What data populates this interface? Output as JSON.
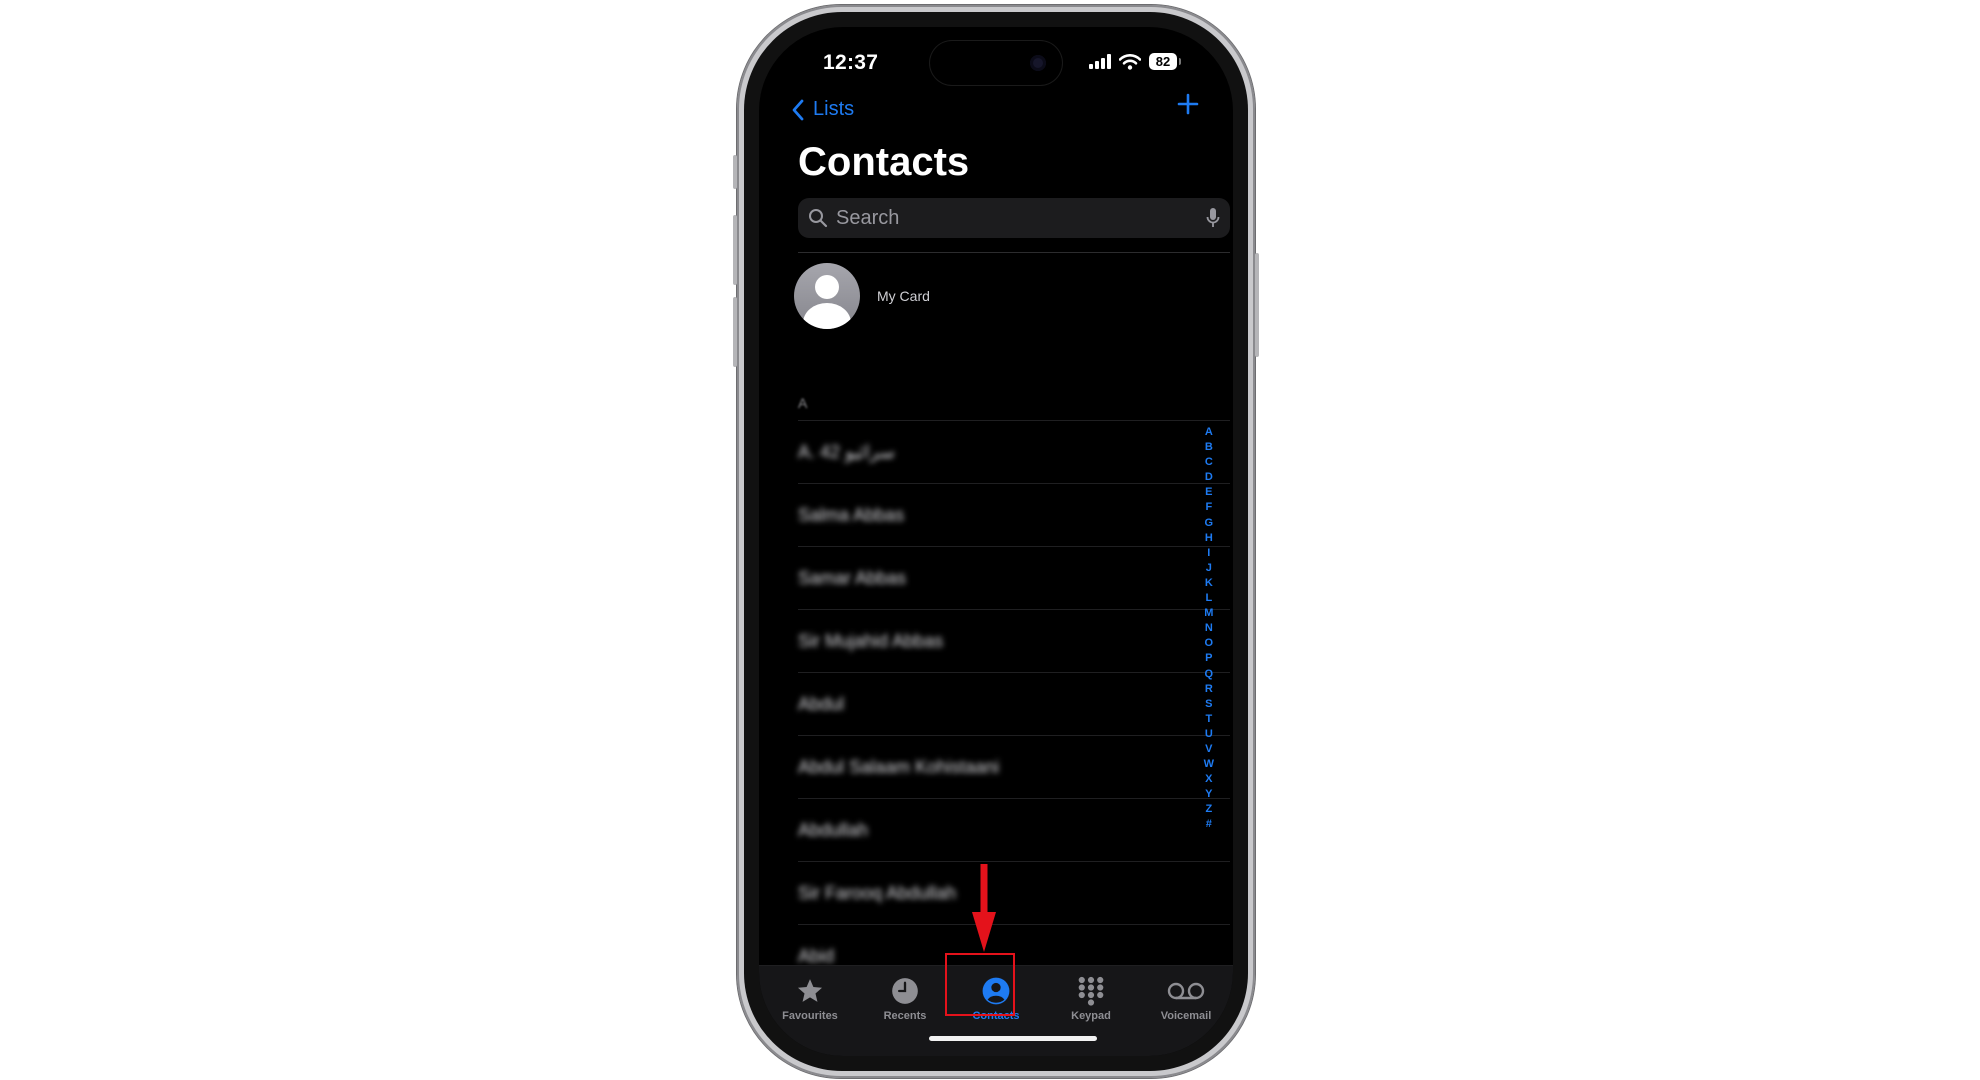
{
  "status_bar": {
    "time": "12:37",
    "battery": "82"
  },
  "nav": {
    "back_label": "Lists"
  },
  "page_title": "Contacts",
  "search": {
    "placeholder": "Search"
  },
  "my_card": {
    "label": "My Card"
  },
  "section_header": "A",
  "contacts": [
    "A. 42 سرائیو",
    "Salma Abbas",
    "Samar Abbas",
    "Sir Mujahid Abbas",
    "Abdul",
    "Abdul Salaam Kohistaani",
    "Abdullah",
    "Sir Farooq Abdullah",
    "Abid"
  ],
  "index_letters": [
    "A",
    "B",
    "C",
    "D",
    "E",
    "F",
    "G",
    "H",
    "I",
    "J",
    "K",
    "L",
    "M",
    "N",
    "O",
    "P",
    "Q",
    "R",
    "S",
    "T",
    "U",
    "V",
    "W",
    "X",
    "Y",
    "Z",
    "#"
  ],
  "tabs": [
    {
      "label": "Favourites",
      "icon": "star-icon",
      "active": false
    },
    {
      "label": "Recents",
      "icon": "clock-icon",
      "active": false
    },
    {
      "label": "Contacts",
      "icon": "person-circle-icon",
      "active": true
    },
    {
      "label": "Keypad",
      "icon": "keypad-grid-icon",
      "active": false
    },
    {
      "label": "Voicemail",
      "icon": "voicemail-icon",
      "active": false
    }
  ],
  "colors": {
    "accent": "#1e7bf2",
    "annotation": "#e4121b",
    "background": "#000000"
  }
}
